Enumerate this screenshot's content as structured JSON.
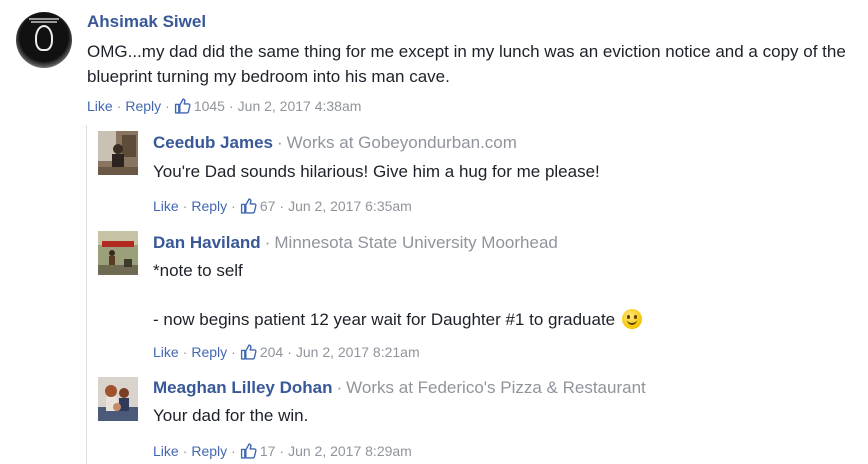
{
  "comment": {
    "author": "Ahsimak Siwel",
    "text": "OMG...my dad did the same thing for me except in my lunch was an eviction notice and a copy of the blueprint turning my bedroom into his man cave.",
    "like_label": "Like",
    "reply_label": "Reply",
    "likes": "1045",
    "timestamp": "Jun 2, 2017 4:38am"
  },
  "replies": [
    {
      "author": "Ceedub James",
      "work": "Works at Gobeyondurban.com",
      "text": "You're Dad sounds hilarious! Give him a hug for me please!",
      "like_label": "Like",
      "reply_label": "Reply",
      "likes": "67",
      "timestamp": "Jun 2, 2017 6:35am"
    },
    {
      "author": "Dan Haviland",
      "work": "Minnesota State University Moorhead",
      "text_line1": "*note to self",
      "text_line2": "- now begins patient 12 year wait for Daughter #1 to graduate",
      "like_label": "Like",
      "reply_label": "Reply",
      "likes": "204",
      "timestamp": "Jun 2, 2017 8:21am"
    },
    {
      "author": "Meaghan Lilley Dohan",
      "work": "Works at Federico's Pizza & Restaurant",
      "text": "Your dad for the win.",
      "like_label": "Like",
      "reply_label": "Reply",
      "likes": "17",
      "timestamp": "Jun 2, 2017 8:29am"
    }
  ],
  "colors": {
    "link": "#385898",
    "action": "#4267b2",
    "meta": "#90949c"
  },
  "icons": {
    "like": "thumbs-up-icon",
    "emoji": "smiley-icon"
  }
}
